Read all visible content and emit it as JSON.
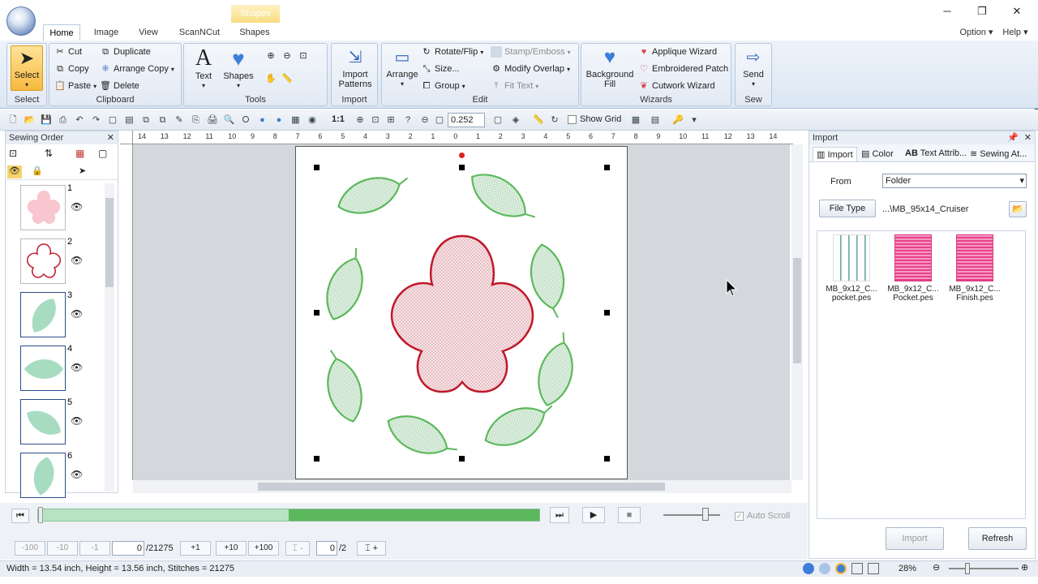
{
  "window": {
    "minimize": "─",
    "restore": "❐",
    "close": "✕"
  },
  "context_tab": "Shapes",
  "tabs": [
    "Home",
    "Image",
    "View",
    "ScanNCut",
    "Shapes"
  ],
  "tabs_right": {
    "option": "Option",
    "help": "Help"
  },
  "ribbon": {
    "select": {
      "label": "Select",
      "group": "Select"
    },
    "clipboard": {
      "cut": "Cut",
      "copy": "Copy",
      "paste": "Paste",
      "duplicate": "Duplicate",
      "arrange_copy": "Arrange Copy",
      "delete": "Delete",
      "group": "Clipboard"
    },
    "tools": {
      "text": "Text",
      "shapes": "Shapes",
      "group": "Tools"
    },
    "import": {
      "label1": "Import",
      "label2": "Patterns",
      "group": "Import"
    },
    "edit": {
      "arrange": "Arrange",
      "rotate": "Rotate/Flip",
      "size": "Size...",
      "group_btn": "Group",
      "stamp": "Stamp/Emboss",
      "modify": "Modify Overlap",
      "fit_text": "Fit Text",
      "group": "Edit"
    },
    "wizards": {
      "background1": "Background",
      "background2": "Fill",
      "applique": "Applique Wizard",
      "patch": "Embroidered Patch",
      "cutwork": "Cutwork Wizard",
      "group": "Wizards"
    },
    "sew": {
      "send": "Send",
      "group": "Sew"
    }
  },
  "toolbar": {
    "zoom_value": "0.252",
    "one_to_one": "1:1",
    "show_grid": "Show Grid"
  },
  "sewing_order": {
    "title": "Sewing Order",
    "items": [
      {
        "num": "1",
        "kind": "flower-fill",
        "color": "#f8c6cf"
      },
      {
        "num": "2",
        "kind": "flower-outline",
        "color": "#c0182a"
      },
      {
        "num": "3",
        "kind": "leaf",
        "color": "#a7dcc1"
      },
      {
        "num": "4",
        "kind": "leaf",
        "color": "#a7dcc1"
      },
      {
        "num": "5",
        "kind": "leaf",
        "color": "#a7dcc1"
      },
      {
        "num": "6",
        "kind": "leaf",
        "color": "#a7dcc1"
      }
    ]
  },
  "ruler": {
    "h_labels": [
      "14",
      "13",
      "12",
      "11",
      "10",
      "9",
      "8",
      "7",
      "6",
      "5",
      "4",
      "3",
      "2",
      "1",
      "0",
      "1",
      "2",
      "3",
      "4",
      "5",
      "6",
      "7",
      "8",
      "9",
      "10",
      "11",
      "12",
      "13",
      "14"
    ]
  },
  "import_panel": {
    "title": "Import",
    "tabs": [
      "Import",
      "Color",
      "Text Attrib...",
      "Sewing At..."
    ],
    "from_label": "From",
    "from_value": "Folder",
    "file_type_button": "File Type",
    "path": "...\\MB_95x14_Cruiser",
    "files": [
      {
        "line1": "MB_9x12_C...",
        "line2": "pocket.pes"
      },
      {
        "line1": "MB_9x12_C...",
        "line2": "Pocket.pes"
      },
      {
        "line1": "MB_9x12_C...",
        "line2": "Finish.pes"
      }
    ],
    "import_button": "Import",
    "refresh_button": "Refresh"
  },
  "playback": {
    "progress": 0.5,
    "auto_scroll": "Auto Scroll",
    "stitch_current": "0",
    "stitch_total": "/21275",
    "steps": [
      "-100",
      "-10",
      "-1",
      "+1",
      "+10",
      "+100"
    ],
    "page_current": "0",
    "page_total": "/2"
  },
  "status": {
    "text": "Width = 13.54 inch, Height = 13.56 inch, Stitches = 21275",
    "zoom": "28%"
  },
  "colors": {
    "leaf": "#5cb85c",
    "leaf_fill": "#d6ead9",
    "flower": "#c0182a",
    "flower_fill": "#f1d8dc",
    "accent_green": "#5cb85c"
  }
}
